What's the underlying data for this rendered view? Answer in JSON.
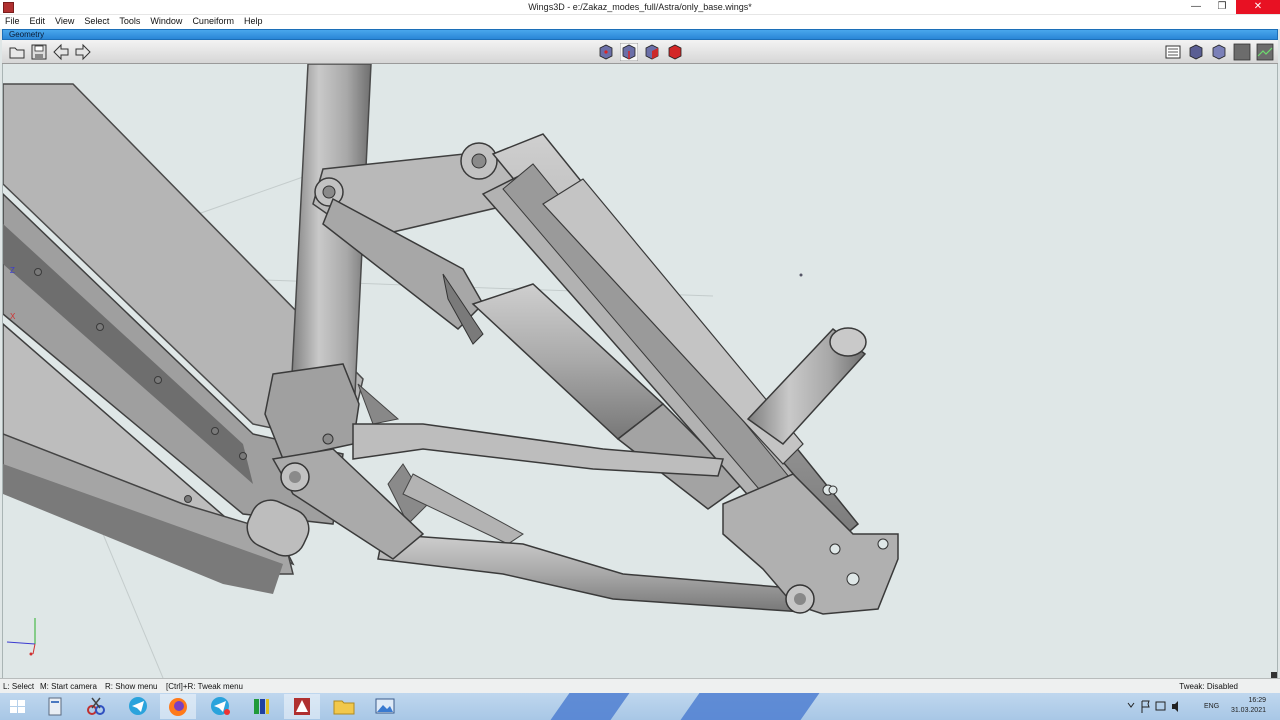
{
  "window": {
    "title": "Wings3D - e:/Zakaz_modes_full/Astra/only_base.wings*",
    "min_symbol": "—",
    "max_symbol": "❐",
    "close_symbol": "✕"
  },
  "menu": [
    "File",
    "Edit",
    "View",
    "Select",
    "Tools",
    "Window",
    "Cuneiform",
    "Help"
  ],
  "geometry_panel": {
    "title": "Geometry"
  },
  "toolbar": {
    "left_icons": [
      "open-icon",
      "save-icon",
      "undo-arrow-icon",
      "redo-arrow-icon"
    ],
    "mode_icons": [
      "vertex-mode-icon",
      "edge-mode-icon",
      "face-mode-icon",
      "body-mode-icon"
    ],
    "right_icons": [
      "workmode-icon",
      "flat-shade-icon",
      "smooth-shade-icon",
      "wireframe-icon",
      "perspective-icon"
    ]
  },
  "viewport": {
    "axis_z": "Z",
    "axis_x": "X",
    "model": "bicycle-frame-suspension"
  },
  "status": {
    "select": "L: Select",
    "camera": "M: Start camera",
    "menu": "R: Show menu",
    "tweak_menu": "[Ctrl]+R: Tweak menu",
    "tweak_state": "Tweak: Disabled"
  },
  "taskbar": {
    "apps": [
      "windows-start-icon",
      "file-icon",
      "scissors-icon",
      "telegram-icon",
      "firefox-icon",
      "telegram-icon-2",
      "app-green-icon",
      "wings3d-icon",
      "folder-icon",
      "picture-icon"
    ],
    "language": "ENG",
    "time": "16:29",
    "date": "31.03.2021"
  },
  "colors": {
    "accent": "#2a86d6",
    "viewport_bg": "#dfe7e7",
    "model": "#a9a9a9",
    "close_btn": "#e81123"
  }
}
